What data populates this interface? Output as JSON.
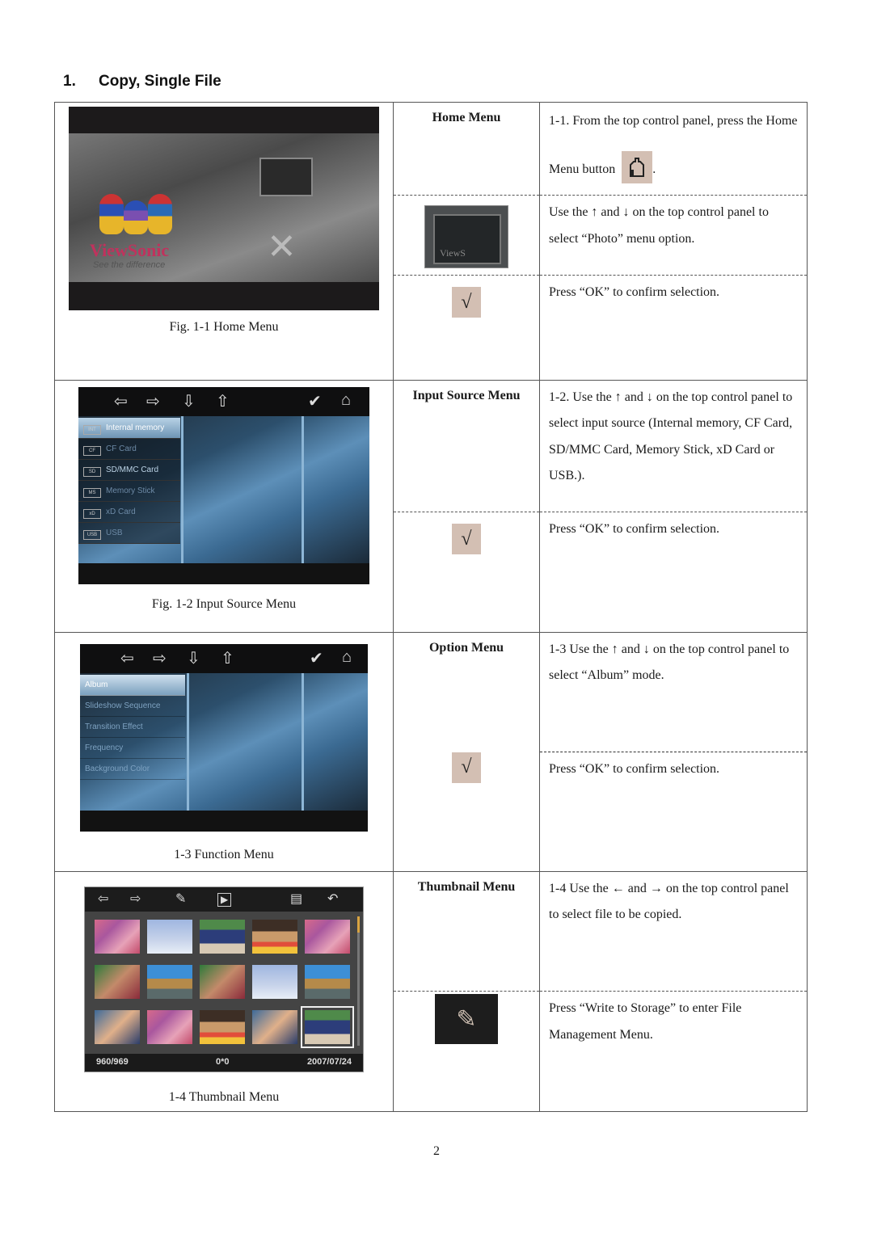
{
  "heading": {
    "number": "1.",
    "title": "Copy, Single File"
  },
  "rows": [
    {
      "caption": "Fig. 1-1 Home Menu",
      "label": "Home Menu",
      "screen": {
        "brand": "ViewSonic",
        "tagline": "See the difference",
        "icons": [
          "photo-icon",
          "tools-icon"
        ]
      },
      "steps": [
        {
          "text_before": "1-1. From the top control panel, press the Home Menu button",
          "text_after": ".",
          "icon": "home-icon"
        },
        {
          "text": "Use the ↑ and ↓ on the top control panel to select “Photo” menu option.",
          "icon": "photo-menu-icon"
        },
        {
          "text": "Press “OK” to confirm selection.",
          "icon": "checkmark-icon"
        }
      ]
    },
    {
      "caption": "Fig. 1-2 Input Source Menu",
      "label": "Input Source Menu",
      "screen": {
        "toolbar": [
          "⇦",
          "⇨",
          "⇩",
          "⇧",
          "✔",
          "⌂"
        ],
        "items": [
          {
            "chip": "INT",
            "label": "Internal memory",
            "state": "selected"
          },
          {
            "chip": "CF",
            "label": "CF Card",
            "state": "dim"
          },
          {
            "chip": "SD",
            "label": "SD/MMC Card",
            "state": "bright"
          },
          {
            "chip": "MS",
            "label": "Memory Stick",
            "state": "dim"
          },
          {
            "chip": "xD",
            "label": "xD Card",
            "state": "dim"
          },
          {
            "chip": "USB",
            "label": "USB",
            "state": "dim"
          }
        ]
      },
      "steps": [
        {
          "text": "1-2. Use the ↑ and ↓ on the top control panel to select input source (Internal memory, CF Card, SD/MMC Card, Memory Stick, xD Card or USB.)."
        },
        {
          "text": "Press “OK” to confirm selection.",
          "icon": "checkmark-icon"
        }
      ]
    },
    {
      "caption": "1-3 Function Menu",
      "label": "Option Menu",
      "screen": {
        "toolbar": [
          "⇦",
          "⇨",
          "⇩",
          "⇧",
          "✔",
          "⌂"
        ],
        "items": [
          {
            "label": "Album",
            "state": "selected"
          },
          {
            "label": "Slideshow Sequence",
            "state": "normal"
          },
          {
            "label": "Transition Effect",
            "state": "normal"
          },
          {
            "label": "Frequency",
            "state": "normal"
          },
          {
            "label": "Background Color",
            "state": "normal"
          }
        ]
      },
      "steps": [
        {
          "text": "1-3 Use the ↑ and ↓ on the top control panel to select “Album” mode."
        },
        {
          "text": "Press “OK” to confirm selection.",
          "icon": "checkmark-icon"
        }
      ]
    },
    {
      "caption": "1-4 Thumbnail Menu",
      "label": "Thumbnail Menu",
      "screen": {
        "toolbar": [
          "⇦",
          "⇨",
          "✎",
          "▶",
          "▤",
          "↶"
        ],
        "status": {
          "count": "960/969",
          "zoom": "0*0",
          "date": "2007/07/24"
        },
        "thumbnails": [
          "flowers",
          "church",
          "couple",
          "kiss",
          "flowers",
          "hug",
          "lake",
          "hug",
          "church",
          "lake",
          "family",
          "flowers",
          "kiss",
          "family",
          "couple"
        ],
        "selected_index": 14
      },
      "steps": [
        {
          "text": "1-4 Use the ← and → on the top control panel to select file to be copied."
        },
        {
          "text": "Press “Write to Storage” to enter File Management Menu.",
          "icon": "write-to-storage-icon"
        }
      ]
    }
  ],
  "check_glyph": "√",
  "page_number": "2"
}
